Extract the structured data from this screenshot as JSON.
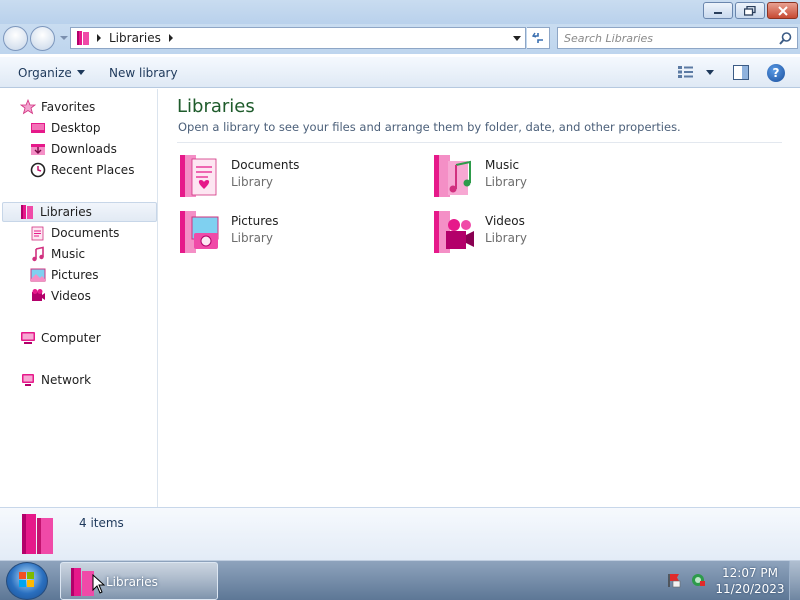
{
  "window": {
    "minimize_label": "minimize",
    "maximize_label": "maximize",
    "close_label": "close"
  },
  "address": {
    "breadcrumb": [
      "Libraries"
    ],
    "search_placeholder": "Search Libraries"
  },
  "toolbar": {
    "organize_label": "Organize",
    "new_library_label": "New library"
  },
  "navpane": {
    "favorites": {
      "label": "Favorites",
      "items": [
        {
          "label": "Desktop",
          "icon": "desktop-icon"
        },
        {
          "label": "Downloads",
          "icon": "downloads-icon"
        },
        {
          "label": "Recent Places",
          "icon": "recent-places-icon"
        }
      ]
    },
    "libraries": {
      "label": "Libraries",
      "items": [
        {
          "label": "Documents",
          "icon": "documents-icon"
        },
        {
          "label": "Music",
          "icon": "music-icon"
        },
        {
          "label": "Pictures",
          "icon": "pictures-icon"
        },
        {
          "label": "Videos",
          "icon": "videos-icon"
        }
      ]
    },
    "computer_label": "Computer",
    "network_label": "Network"
  },
  "content": {
    "title": "Libraries",
    "subtitle": "Open a library to see your files and arrange them by folder, date, and other properties.",
    "libraries": [
      {
        "name": "Documents",
        "type": "Library",
        "icon": "documents-library-icon"
      },
      {
        "name": "Music",
        "type": "Library",
        "icon": "music-library-icon"
      },
      {
        "name": "Pictures",
        "type": "Library",
        "icon": "pictures-library-icon"
      },
      {
        "name": "Videos",
        "type": "Library",
        "icon": "videos-library-icon"
      }
    ]
  },
  "details": {
    "item_count": "4 items"
  },
  "taskbar": {
    "task_label": "Libraries",
    "time": "12:07 PM",
    "date": "11/20/2023"
  },
  "colors": {
    "accent_pink": "#e6198a",
    "title_green": "#1e5b2b",
    "selection_blue": "#e2eaf4"
  }
}
